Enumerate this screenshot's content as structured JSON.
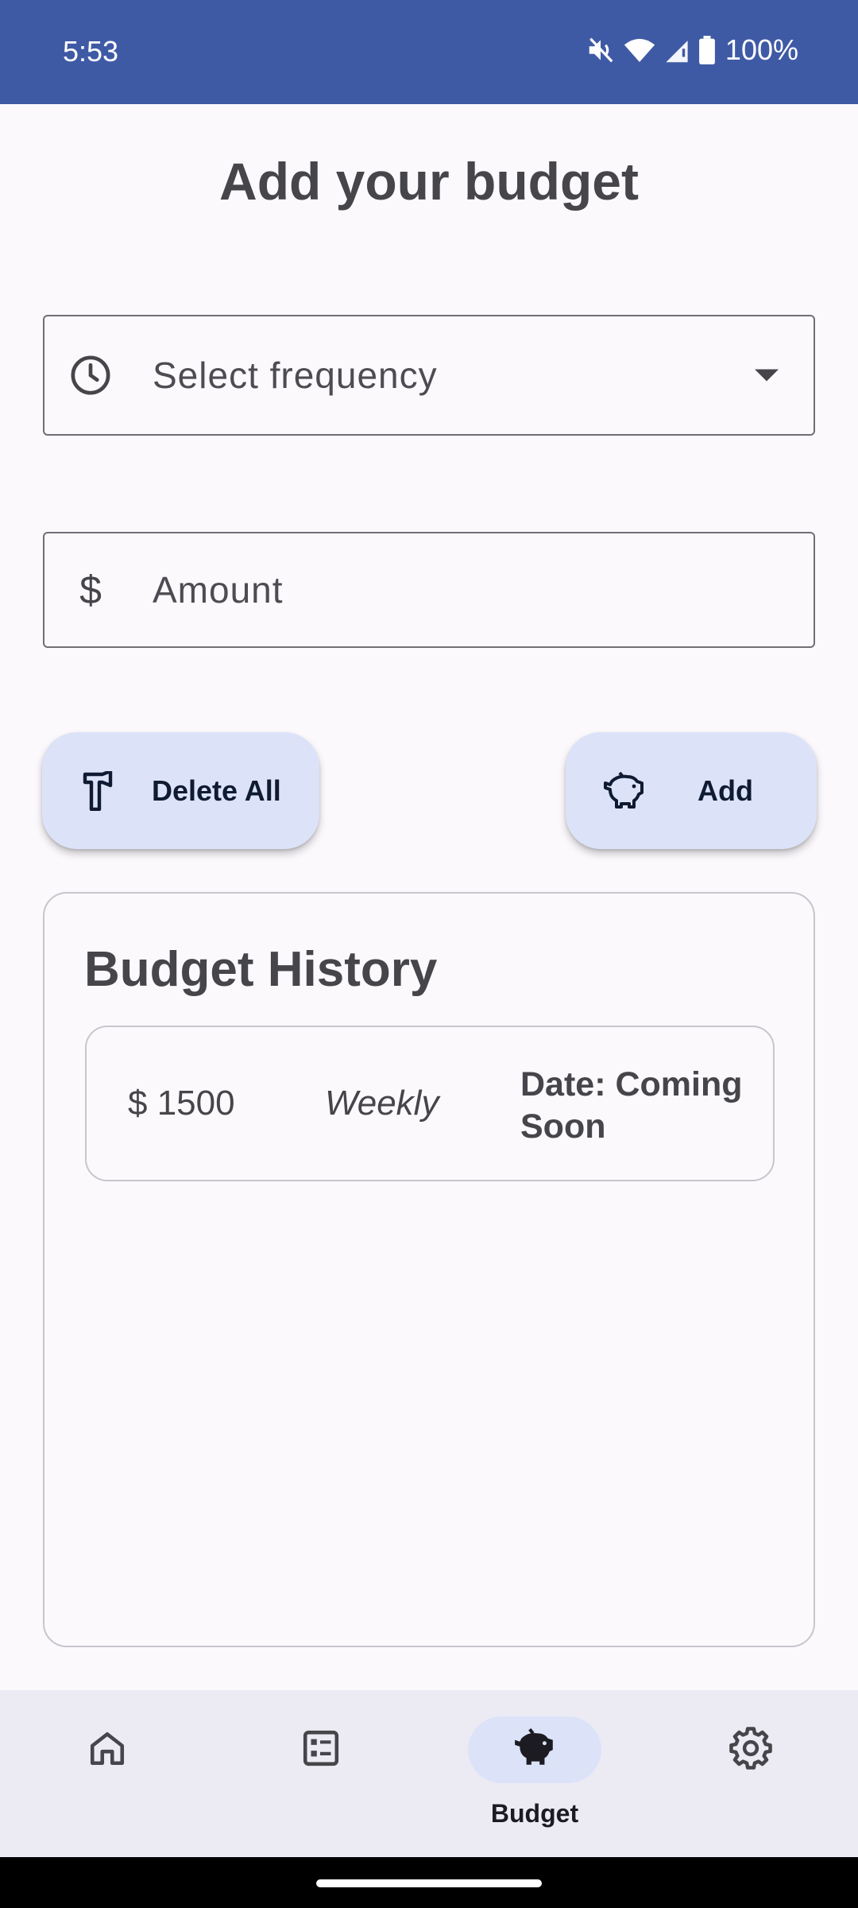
{
  "status_bar": {
    "time": "5:53",
    "battery": "100%",
    "icons": [
      "mute-icon",
      "wifi-icon",
      "signal-icon",
      "battery-icon"
    ]
  },
  "page": {
    "title": "Add your budget"
  },
  "form": {
    "frequency": {
      "placeholder": "Select frequency",
      "icon": "clock-icon"
    },
    "amount": {
      "placeholder": "Amount",
      "prefix": "$"
    }
  },
  "actions": {
    "delete_all_label": "Delete All",
    "add_label": "Add"
  },
  "history": {
    "title": "Budget History",
    "entries": [
      {
        "amount": "$ 1500",
        "frequency": "Weekly",
        "date": "Date: Coming Soon"
      }
    ]
  },
  "bottom_nav": {
    "items": [
      {
        "id": "home",
        "icon": "home-icon",
        "label": ""
      },
      {
        "id": "list",
        "icon": "checklist-icon",
        "label": ""
      },
      {
        "id": "budget",
        "icon": "piggy-bank-icon",
        "label": "Budget",
        "active": true
      },
      {
        "id": "settings",
        "icon": "gear-icon",
        "label": ""
      }
    ]
  },
  "colors": {
    "status_bar": "#3f5aa5",
    "background": "#fcf9fd",
    "button_bg": "#dce3f8",
    "nav_bg": "#ecebf3",
    "text": "#45454a"
  }
}
